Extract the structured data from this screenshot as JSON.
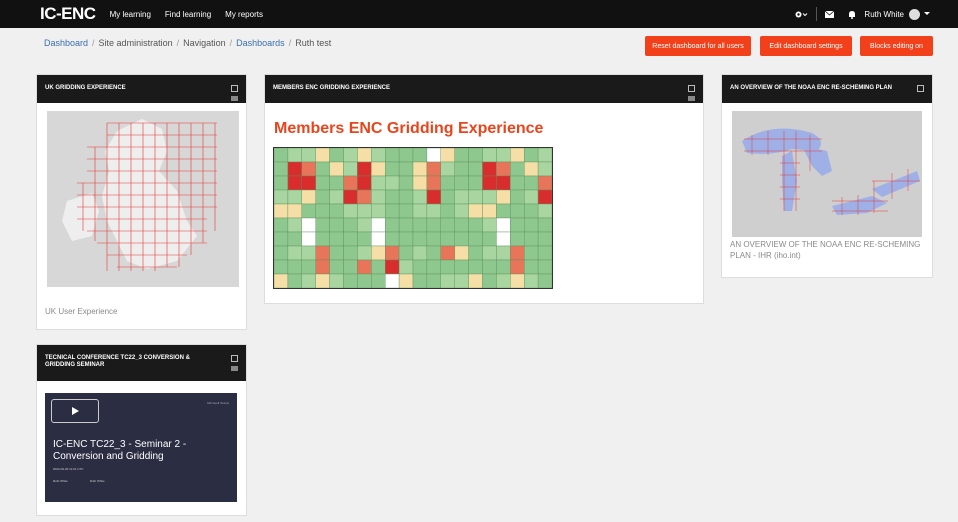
{
  "nav": {
    "brand": "IC-ENC",
    "links": [
      "My learning",
      "Find learning",
      "My reports"
    ],
    "user_name": "Ruth White"
  },
  "breadcrumb": [
    "Dashboard",
    "Site administration",
    "Navigation",
    "Dashboards",
    "Ruth test"
  ],
  "buttons": {
    "reset": "Reset dashboard for all users",
    "edit": "Edit dashboard settings",
    "blocks": "Blocks editing on"
  },
  "blocks": {
    "uk": {
      "title": "UK GRIDDING EXPERIENCE",
      "caption": "UK User Experience"
    },
    "members": {
      "title": "MEMBERS ENC GRIDDING EXPERIENCE",
      "heading": "Members ENC Gridding Experience"
    },
    "noaa": {
      "title": "AN OVERVIEW OF THE NOAA ENC RE-SCHEMING PLAN",
      "caption": "AN OVERVIEW OF THE NOAA ENC RE-SCHEMING PLAN - IHR (iho.int)"
    },
    "tc": {
      "title": "TECNICAL CONFERENCE TC22_3 CONVERSION & GRIDDING SEMINAR",
      "video_brand": "Microsoft Teams",
      "video_title": "IC-ENC TC22_3 - Seminar 2 - Conversion and Gridding",
      "video_date": "2022-09-30 11:01 UTC",
      "person1": "Ruth White",
      "person2": "Ruth White"
    }
  },
  "colors": {
    "accent": "#f2401b",
    "nav": "#111111",
    "link": "#3a6fb0"
  }
}
